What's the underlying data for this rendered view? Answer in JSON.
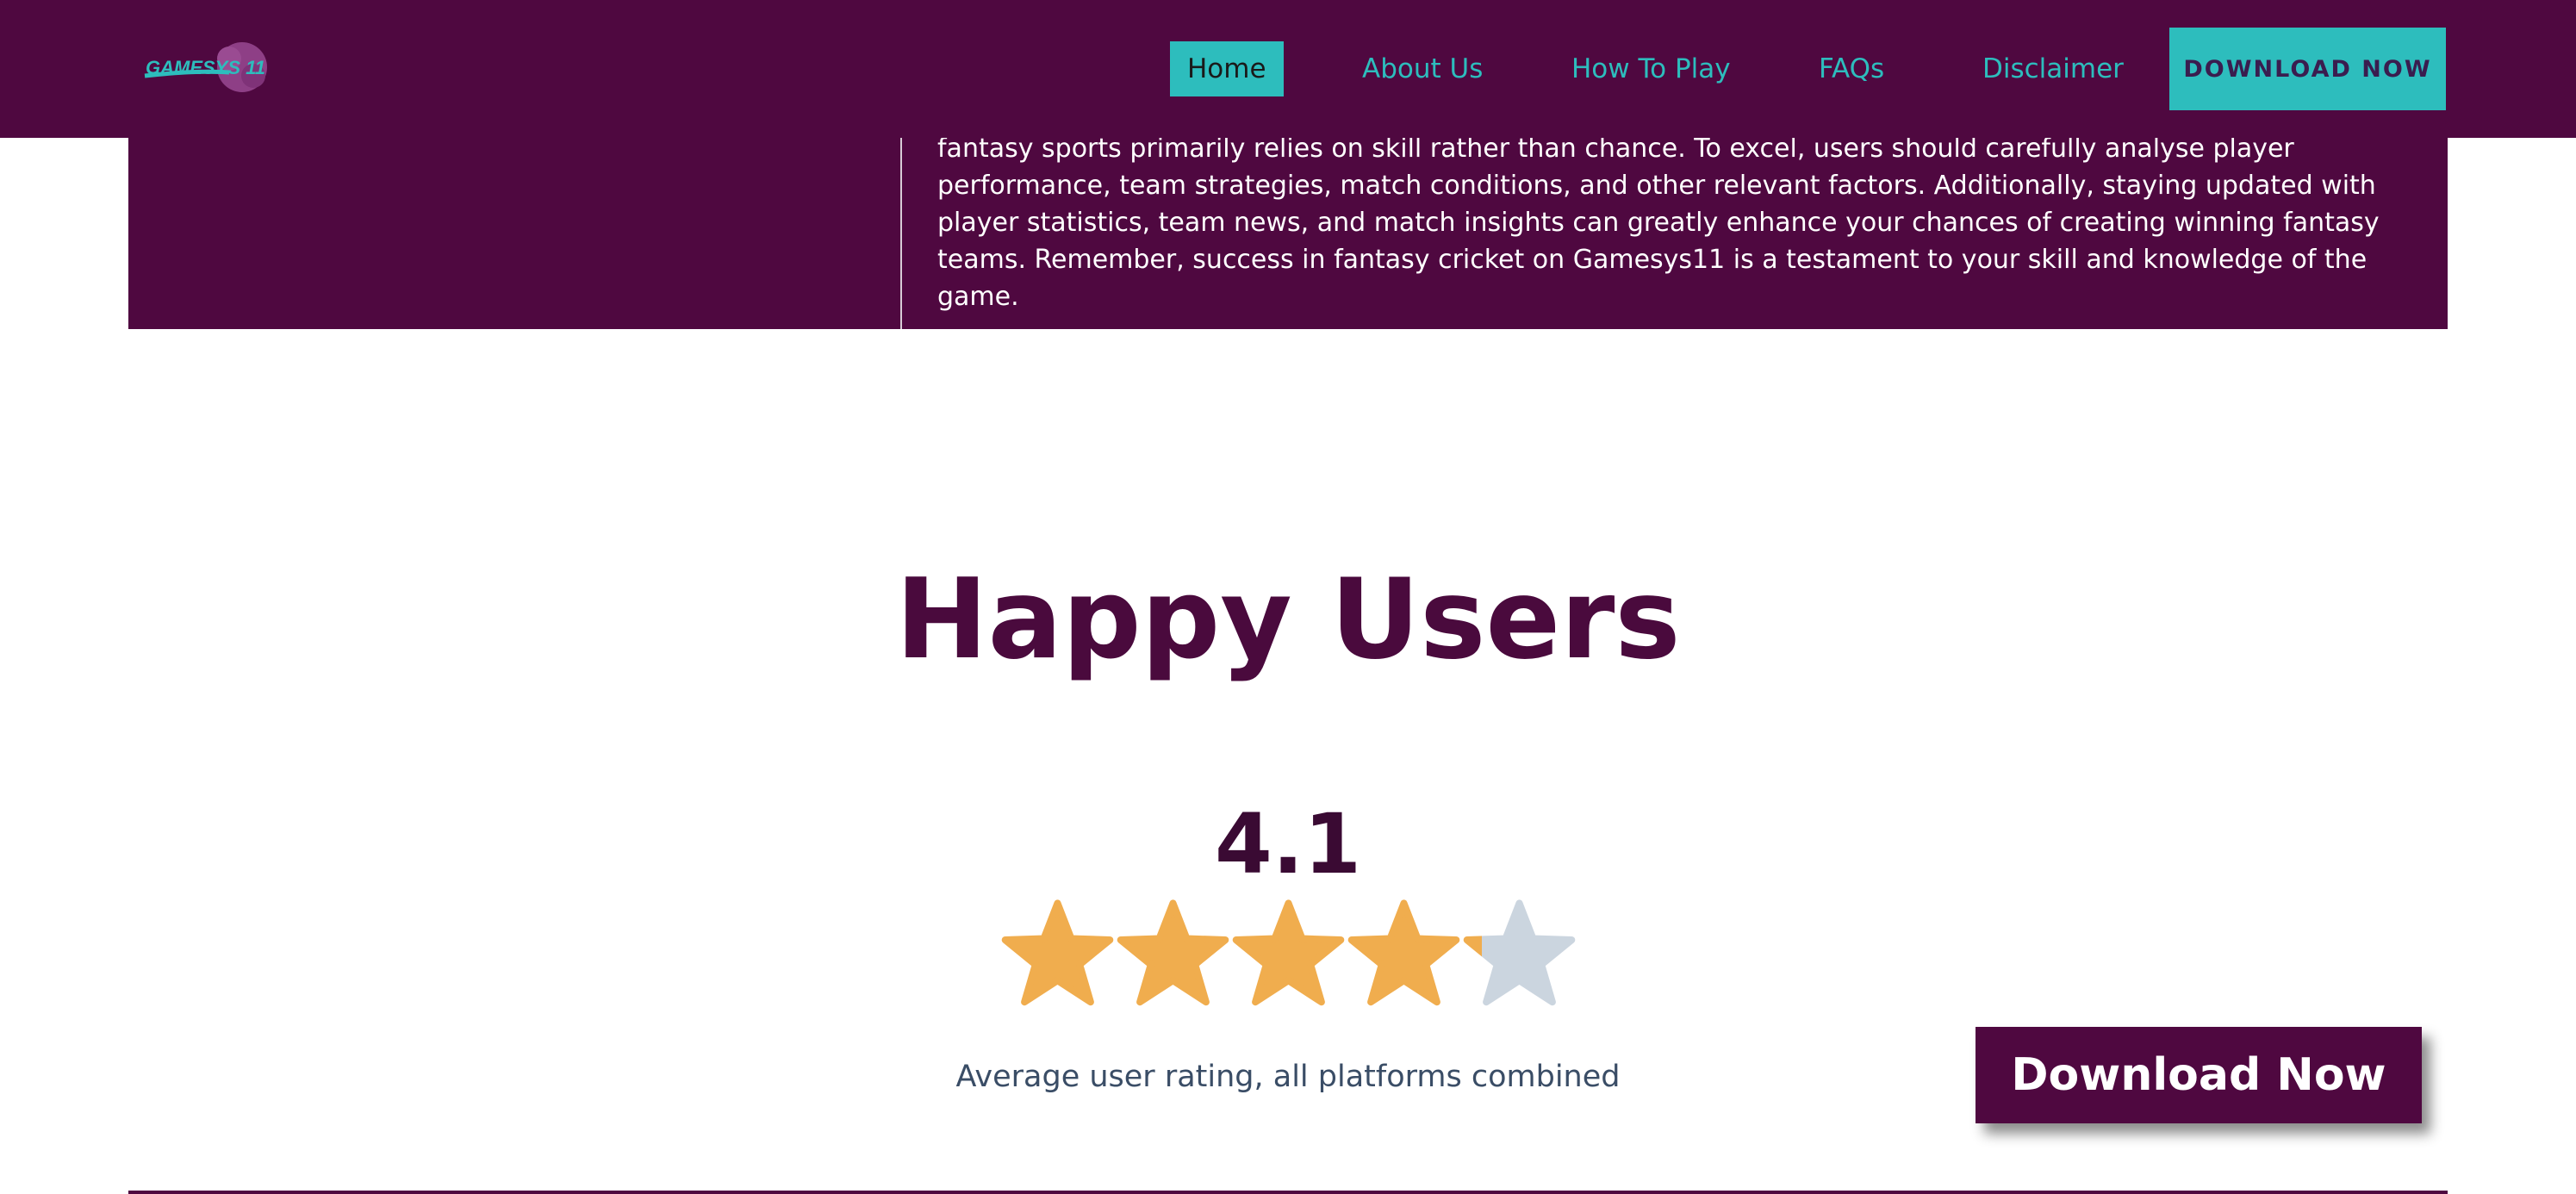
{
  "header": {
    "logo_text": "GAMESYS 11",
    "nav": [
      {
        "label": "Home",
        "active": true
      },
      {
        "label": "About Us",
        "active": false
      },
      {
        "label": "How To Play",
        "active": false
      },
      {
        "label": "FAQs",
        "active": false
      },
      {
        "label": "Disclaimer",
        "active": false
      }
    ],
    "download_label": "DOWNLOAD NOW"
  },
  "content": {
    "paragraph": "fantasy sports primarily relies on skill rather than chance. To excel, users should carefully analyse player performance, team strategies, match conditions, and other relevant factors. Additionally, staying updated with player statistics, team news, and match insights can greatly enhance your chances of creating winning fantasy teams. Remember, success in fantasy cricket on Gamesys11 is a testament to your skill and knowledge of the game."
  },
  "happy_users": {
    "title": "Happy Users",
    "rating": "4.1",
    "rating_value": 4.1,
    "max_rating": 5,
    "caption": "Average user rating, all platforms combined",
    "download_label": "Download Now"
  },
  "colors": {
    "brand_purple": "#4f0840",
    "accent_teal": "#2dbdbd",
    "star_filled": "#f0ad4e",
    "star_empty": "#cbd5df"
  }
}
